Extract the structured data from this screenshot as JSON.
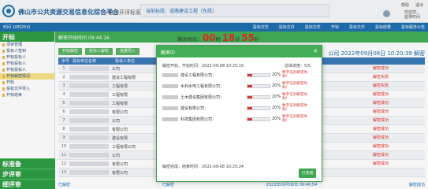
{
  "header": {
    "site_title": "佛山市公共资源交易信息化综合平台",
    "site_sub": "—电子开评标系统",
    "project_prefix": "当前标段：",
    "project_name": "道路建设工程（东段）",
    "tools": [
      "帮助",
      "退出"
    ],
    "user_line1": "欢迎您，",
    "user_line2": "登录时间"
  },
  "nav": {
    "left_text": "时间 10时25分",
    "items": [
      "投标文件",
      "投标文件",
      "投标文件",
      "开标",
      "投标文件",
      "投标结果",
      "投标服务公告"
    ]
  },
  "sidebar": {
    "title": "开标",
    "items": [
      "项目管理",
      "投标人签到",
      "开标投标人",
      "开标投标人",
      "开标投标人",
      "开标解密情况",
      "开标",
      "投标文件导入",
      "开标结束"
    ],
    "active_index": 5,
    "bottom": [
      "标准备",
      "步评审",
      "细评审"
    ]
  },
  "main": {
    "bar_text": "解密开始时间 09:44:16",
    "timer_label": "剩余时间：",
    "timer_h": "00",
    "timer_h_unit": "时",
    "timer_m": "18",
    "timer_m_unit": "分",
    "timer_s": "55",
    "timer_s_unit": "秒",
    "buttons": [
      "开始解密",
      "投标人解密",
      "批量导入"
    ],
    "right_info": "公司  2022年09月08日 10:20:39 解密",
    "table_headers": [
      "序号",
      "投标单位名称",
      "投标人单位",
      "状态"
    ],
    "rows": [
      {
        "no": "1",
        "name": "公司"
      },
      {
        "no": "2",
        "name": "建设工程有限"
      },
      {
        "no": "3",
        "name": "工程有限"
      },
      {
        "no": "4",
        "name": "工程有限"
      },
      {
        "no": "5",
        "name": "工程有限"
      },
      {
        "no": "6",
        "name": "有限公司"
      },
      {
        "no": "7",
        "name": "公司"
      },
      {
        "no": "8",
        "name": "有限公司"
      },
      {
        "no": "9",
        "name": "建设有限"
      },
      {
        "no": "10",
        "name": "工程有限公司"
      },
      {
        "no": "11",
        "name": "公司"
      },
      {
        "no": "12",
        "name": "有限公司"
      },
      {
        "no": "13",
        "name": "有限公司"
      }
    ],
    "right_col": [
      "解密成功",
      "解密失败",
      "解密失败",
      "解密成功",
      "解密成功",
      "解密成功",
      "解密成功",
      "解密成功",
      "解密成功",
      "解密成功",
      "解密成功",
      "解密成功"
    ],
    "footer_left": "已解密",
    "footer_mid": "已解密",
    "footer_time": "2022年09月08日 09:46:54",
    "footer_right": "解密成功"
  },
  "dialog": {
    "title": "解密中",
    "close_icon": "close-icon",
    "start_label": "解密开始，开始时间：2022-09-08 10:25:19",
    "total_label": "总体进度：5/5",
    "rows": [
      {
        "company": "建设工程有限公司：",
        "pct": "20%",
        "progress": 0.2,
        "msg": "数字信封解密失败！"
      },
      {
        "company": "水利水电工程有限公司：",
        "pct": "20%",
        "progress": 0.2,
        "msg": "数字信封解密失败！"
      },
      {
        "company": "土木建设集团有限公司：",
        "pct": "20%",
        "progress": 0.2,
        "msg": "数字信封解密失败！"
      },
      {
        "company": "建设有限公司：",
        "pct": "20%",
        "progress": 0.2,
        "msg": "数字信封解密失败！"
      },
      {
        "company": "科技集团有限公司：",
        "pct": "20%",
        "progress": 0.2,
        "msg": "数字信封解密失败！"
      }
    ],
    "end_label": "解密完成，结束时间：2022-09-08 10:25:24",
    "close_button": "已完成"
  }
}
